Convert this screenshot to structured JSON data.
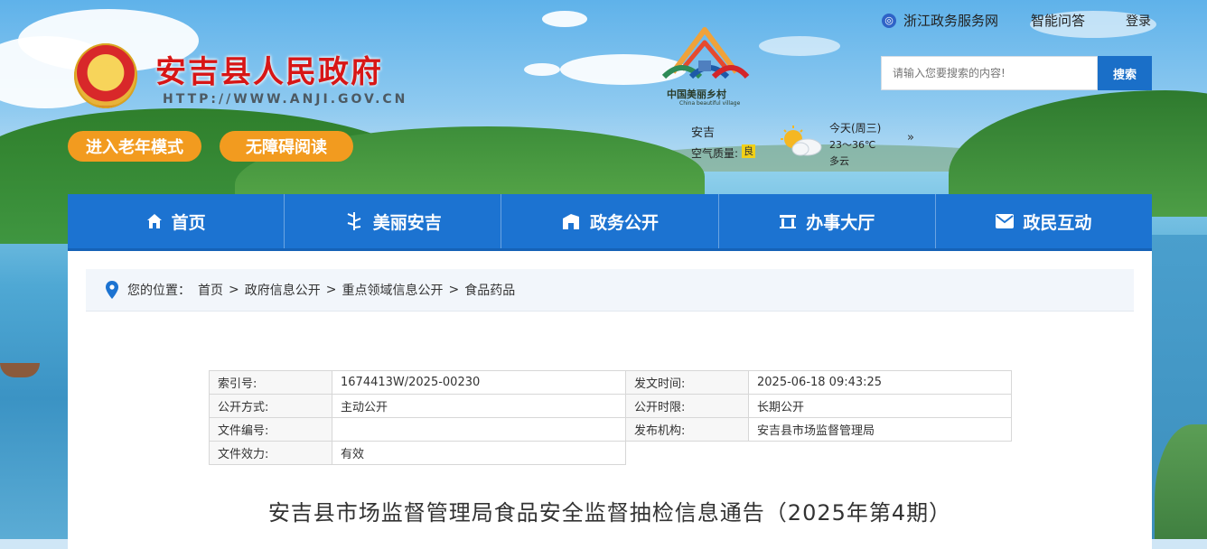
{
  "header": {
    "site_title": "安吉县人民政府",
    "site_url": "HTTP://WWW.ANJI.GOV.CN",
    "elder_mode_label": "进入老年模式",
    "accessible_label": "无障碍阅读",
    "village_logo_text": "中国美丽乡村",
    "village_logo_sub": "China beautiful village",
    "top_links": {
      "zhejiang_service": "浙江政务服务网",
      "smart_qa": "智能问答",
      "login": "登录"
    },
    "search": {
      "placeholder": "请输入您要搜索的内容!",
      "button_label": "搜索"
    },
    "weather": {
      "city": "安吉",
      "air_quality_label": "空气质量:",
      "air_quality_value": "良",
      "day": "今天(周三)",
      "temperature": "23～36℃",
      "condition": "多云",
      "more_icon_glyph": "»"
    }
  },
  "nav": {
    "items": [
      {
        "label": "首页",
        "icon": "home-icon"
      },
      {
        "label": "美丽安吉",
        "icon": "bamboo-icon"
      },
      {
        "label": "政务公开",
        "icon": "building-icon"
      },
      {
        "label": "办事大厅",
        "icon": "hall-icon"
      },
      {
        "label": "政民互动",
        "icon": "mail-icon"
      }
    ]
  },
  "breadcrumb": {
    "prefix": "您的位置：",
    "items": [
      "首页",
      "政府信息公开",
      "重点领域信息公开",
      "食品药品"
    ],
    "separator": ">"
  },
  "meta_table": {
    "index_label": "索引号:",
    "index_value": "1674413W/2025-00230",
    "issue_time_label": "发文时间:",
    "issue_time_value": "2025-06-18 09:43:25",
    "open_method_label": "公开方式:",
    "open_method_value": "主动公开",
    "open_limit_label": "公开时限:",
    "open_limit_value": "长期公开",
    "doc_number_label": "文件编号:",
    "doc_number_value": "",
    "publisher_label": "发布机构:",
    "publisher_value": "安吉县市场监督管理局",
    "validity_label": "文件效力:",
    "validity_value": "有效"
  },
  "article": {
    "title": "安吉县市场监督管理局食品安全监督抽检信息通告（2025年第4期）"
  },
  "colors": {
    "nav_blue": "#1c73d1",
    "title_red": "#d71616",
    "pill_orange": "#f29b1f",
    "search_blue": "#1a6fc8"
  }
}
